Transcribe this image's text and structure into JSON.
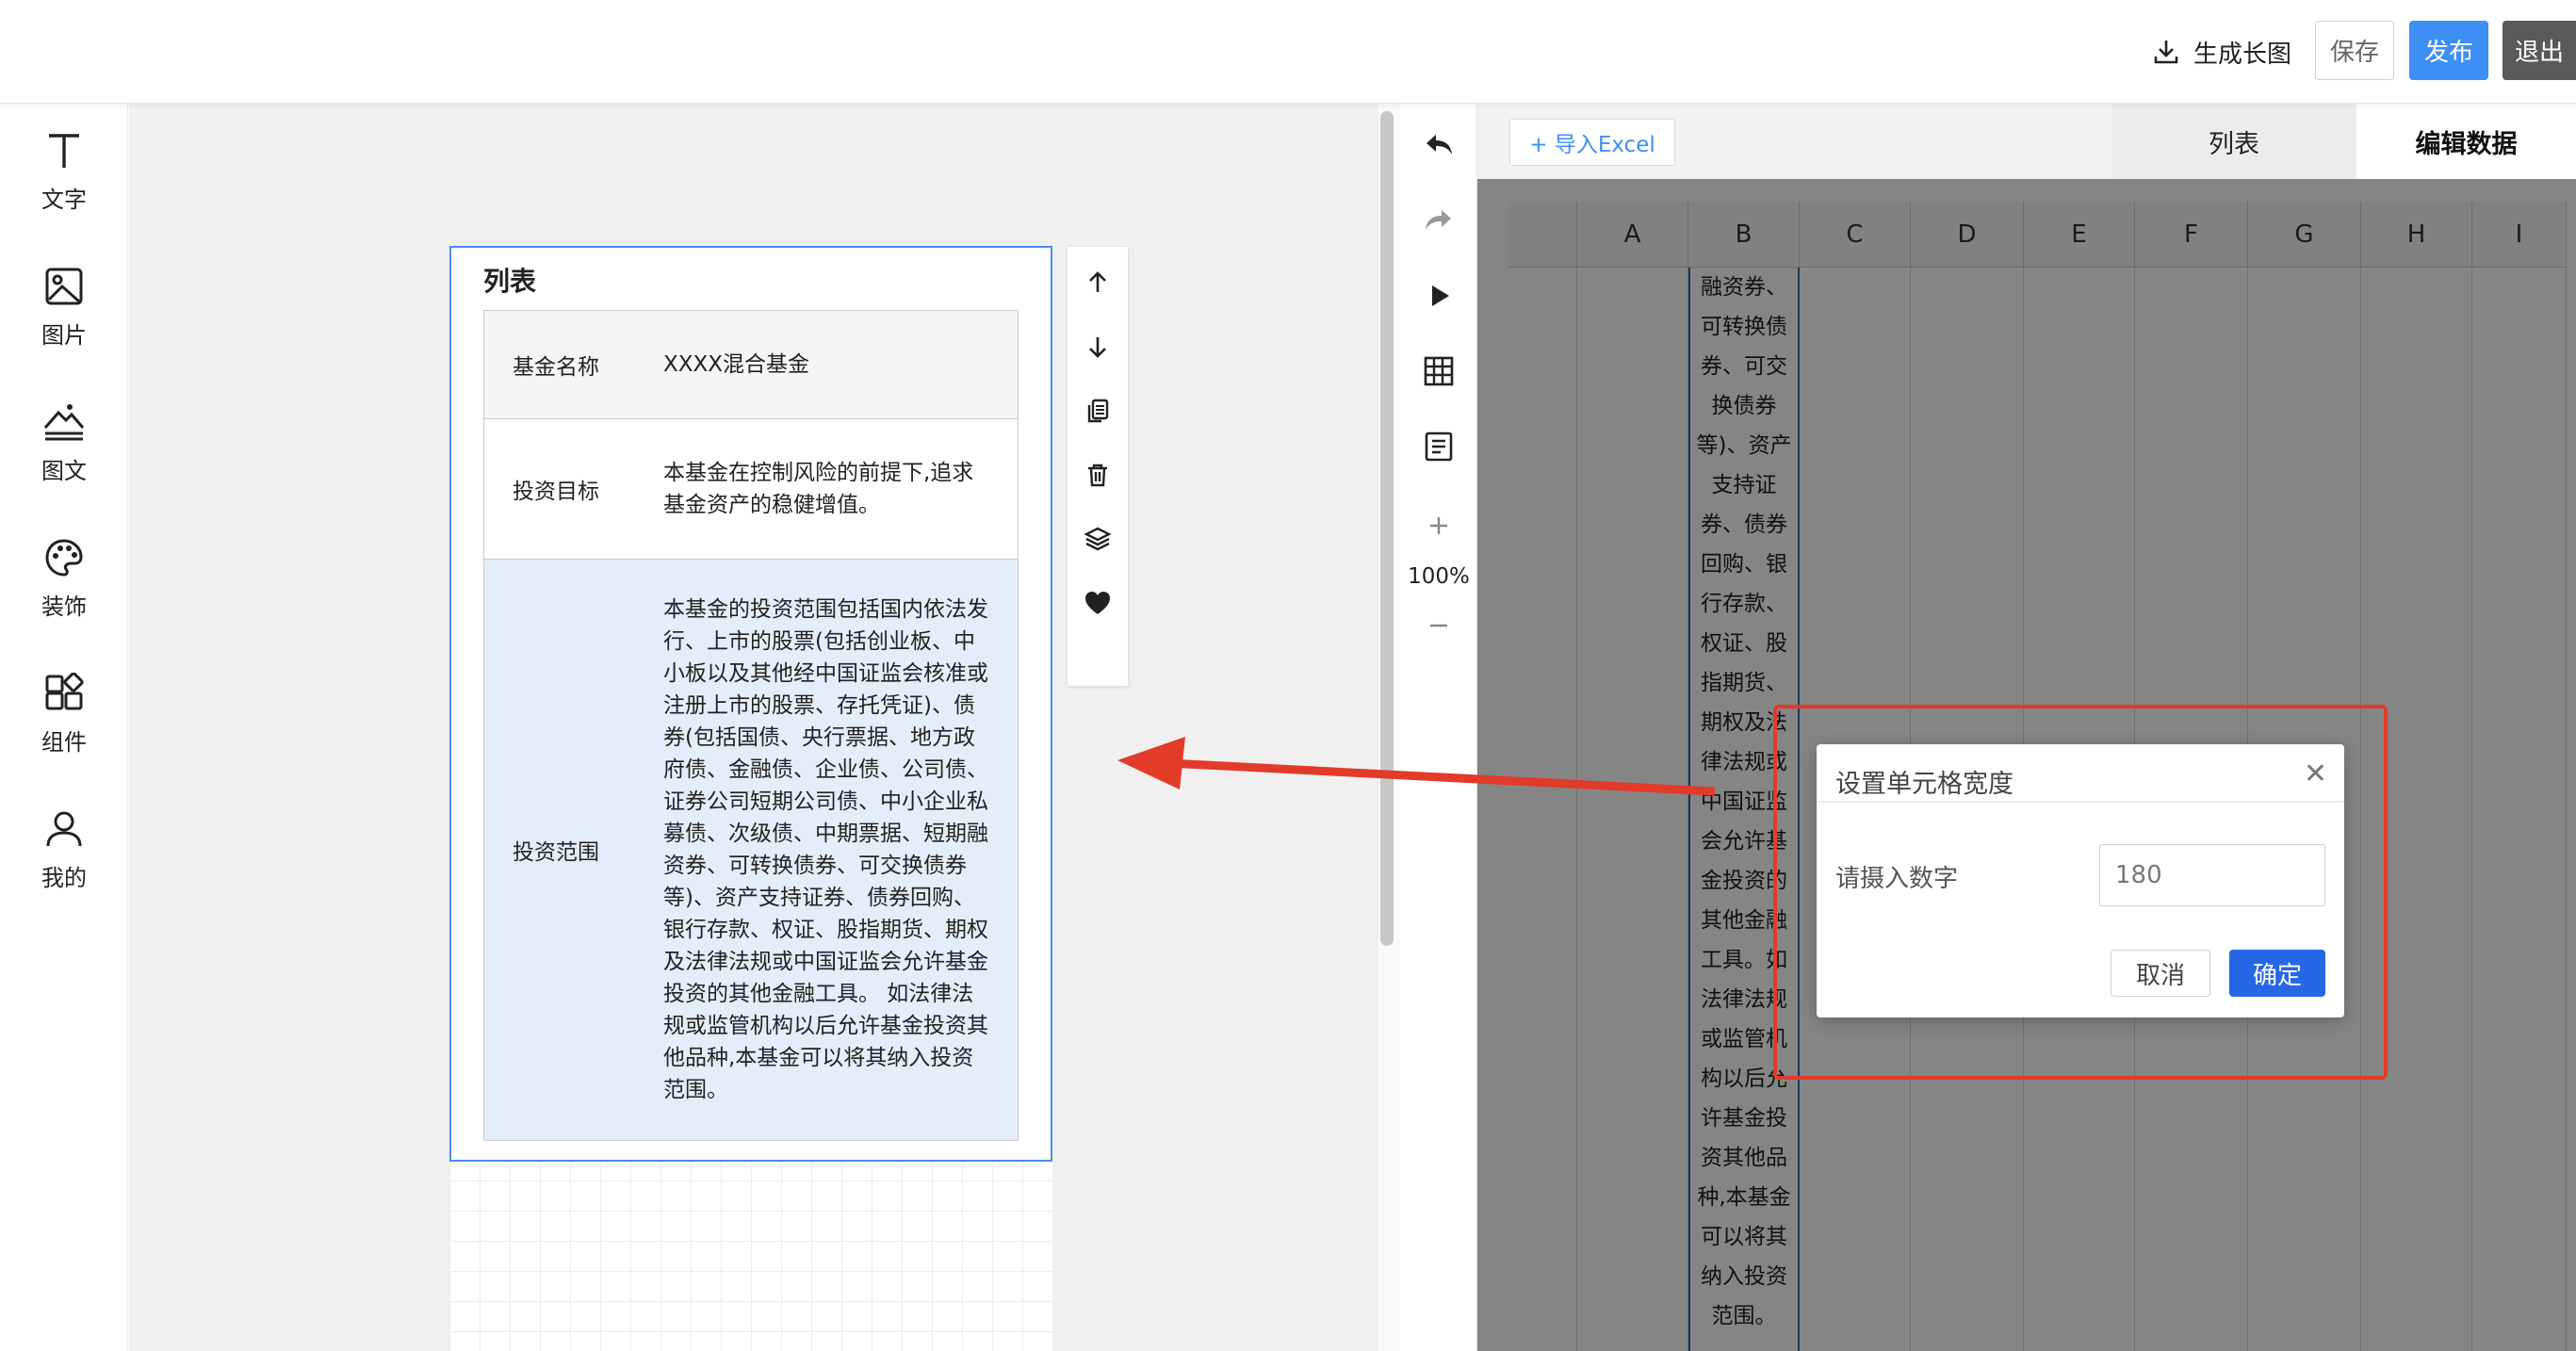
{
  "header": {
    "generate_label": "生成长图",
    "save_label": "保存",
    "publish_label": "发布",
    "exit_label": "退出"
  },
  "leftbar": {
    "items": [
      {
        "label": "文字",
        "icon": "text-icon"
      },
      {
        "label": "图片",
        "icon": "image-icon"
      },
      {
        "label": "图文",
        "icon": "image-text-icon"
      },
      {
        "label": "装饰",
        "icon": "palette-icon"
      },
      {
        "label": "组件",
        "icon": "components-icon"
      },
      {
        "label": "我的",
        "icon": "user-icon"
      }
    ]
  },
  "canvas": {
    "list_title": "列表",
    "rows": [
      {
        "key": "基金名称",
        "value": "XXXX混合基金"
      },
      {
        "key": "投资目标",
        "value": "本基金在控制风险的前提下,追求基金资产的稳健增值。"
      },
      {
        "key": "投资范围",
        "value": "本基金的投资范围包括国内依法发行、上市的股票(包括创业板、中小板以及其他经中国证监会核准或注册上市的股票、存托凭证)、债券(包括国债、央行票据、地方政府债、金融债、企业债、公司债、证券公司短期公司债、中小企业私募债、次级债、中期票据、短期融资券、可转换债券、可交换债券等)、资产支持证券、债券回购、银行存款、权证、股指期货、期权及法律法规或中国证监会允许基金投资的其他金融工具。 如法律法规或监管机构以后允许基金投资其他品种,本基金可以将其纳入投资范围。"
      }
    ]
  },
  "midbar": {
    "zoom": "100%"
  },
  "editor": {
    "import_label": "+ 导入Excel",
    "tab_list": "列表",
    "tab_edit": "编辑数据",
    "columns": [
      "A",
      "B",
      "C",
      "D",
      "E",
      "F",
      "G",
      "H",
      "I"
    ],
    "cell_b_text": "融资券、可转换债券、可交换债券等)、资产支持证券、债券回购、银行存款、权证、股指期货、期权及法律法规或中国证监会允许基金投资的其他金融工具。如法律法规或监管机构以后允许基金投资其他品种,本基金可以将其纳入投资范围。"
  },
  "dialog": {
    "title": "设置单元格宽度",
    "label": "请摄入数字",
    "input_value": "180",
    "cancel_label": "取消",
    "ok_label": "确定"
  },
  "colors": {
    "accent": "#3d8ff5",
    "confirm": "#2667e6",
    "annotation": "#e23b2a",
    "selection": "#4a8ef0"
  }
}
